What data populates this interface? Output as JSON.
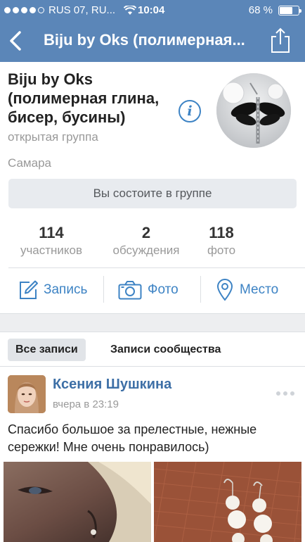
{
  "status_bar": {
    "carrier": "RUS 07, RU...",
    "time": "10:04",
    "battery": "68 %",
    "battery_level": 0.68,
    "signal_bars_filled": 4,
    "signal_bars_total": 5
  },
  "nav": {
    "title": "Biju by Oks (полимерная...",
    "back_icon": "chevron-left-icon",
    "share_icon": "share-icon"
  },
  "group": {
    "name": "Biju by Oks (полимерная глина, бисер, бусины)",
    "type": "открытая группа",
    "city": "Самара",
    "info_icon": "info-icon",
    "membership_button": "Вы состоите в группе"
  },
  "stats": [
    {
      "count": "114",
      "label": "участников"
    },
    {
      "count": "2",
      "label": "обсуждения"
    },
    {
      "count": "118",
      "label": "фото"
    }
  ],
  "actions": [
    {
      "label": "Запись",
      "icon": "compose-icon"
    },
    {
      "label": "Фото",
      "icon": "camera-icon"
    },
    {
      "label": "Место",
      "icon": "location-pin-icon"
    }
  ],
  "tabs": [
    {
      "label": "Все записи",
      "active": true
    },
    {
      "label": "Записи сообщества",
      "active": false
    }
  ],
  "post": {
    "author": "Ксения Шушкина",
    "time": "вчера в 23:19",
    "text": "Спасибо большое за прелестные, нежные сережки! Мне очень понравилось)",
    "menu_icon": "more-dots-icon"
  },
  "colors": {
    "header": "#5b86b8",
    "accent": "#3d83c4",
    "author_link": "#3d6fa6",
    "muted_text": "#999999",
    "button_bg": "#e8ebef"
  }
}
